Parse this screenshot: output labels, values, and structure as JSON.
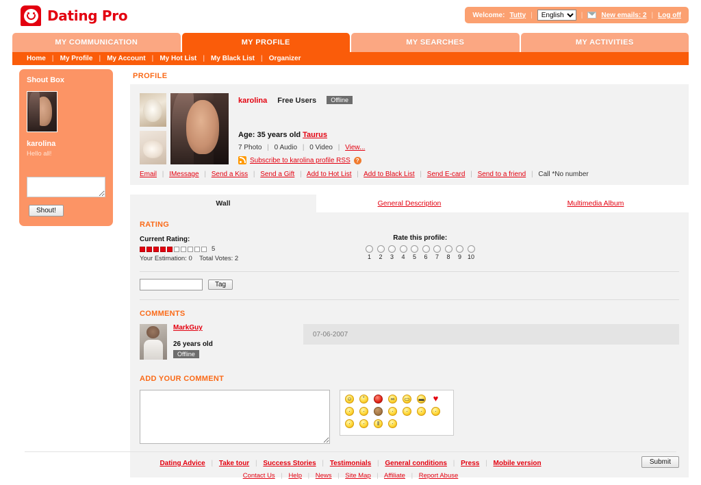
{
  "brand": {
    "name": "Dating Pro",
    "logo_icon": "smiley-logo-icon",
    "accent": "#e3000f",
    "orange": "#fa5c0a"
  },
  "welcome": {
    "prefix": "Welcome:",
    "username": "Tutty",
    "language": "English",
    "language_options": [
      "English"
    ],
    "mail_icon": "envelope-icon",
    "new_emails": "New emails: 2",
    "logoff": "Log off",
    "sep": "|"
  },
  "tabs": [
    {
      "label": "MY COMMUNICATION",
      "active": false
    },
    {
      "label": "MY PROFILE",
      "active": true
    },
    {
      "label": "MY SEARCHES",
      "active": false
    },
    {
      "label": "MY ACTIVITIES",
      "active": false
    }
  ],
  "subnav": [
    "Home",
    "My Profile",
    "My Account",
    "My Hot List",
    "My Black List",
    "Organizer"
  ],
  "shoutbox": {
    "title": "Shout Box",
    "avatar_icon": "karolina-avatar",
    "name": "karolina",
    "message": "Hello all!",
    "input_value": "",
    "button_label": "Shout!"
  },
  "main": {
    "section_title": "PROFILE",
    "profile": {
      "thumbs": [
        "cat-thumb-1",
        "cat-thumb-2"
      ],
      "main_photo": "karolina-main-photo",
      "name": "karolina",
      "user_type": "Free Users",
      "status": "Offline",
      "age_label": "Age: 35 years old",
      "zodiac": "Taurus",
      "photo_count": "7 Photo",
      "audio_count": "0 Audio",
      "video_count": "0 Video",
      "view_link": "View...",
      "rss_icon": "rss-icon",
      "rss_link": "Subscribe to karolina profile RSS",
      "help_icon": "question-icon",
      "actions": [
        "Email",
        "IMessage",
        "Send a Kiss",
        "Send a Gift",
        "Add to Hot List",
        "Add to Black List",
        "Send E-card",
        "Send to a friend"
      ],
      "call_text": "Call *No number"
    },
    "content_tabs": [
      {
        "label": "Wall",
        "active": true
      },
      {
        "label": "General Description",
        "active": false
      },
      {
        "label": "Multimedia Album",
        "active": false
      }
    ],
    "rating": {
      "heading": "RATING",
      "current_label": "Current Rating:",
      "filled": 5,
      "total": 10,
      "score": "5",
      "your_estimation": "Your Estimation: 0",
      "total_votes": "Total Votes: 2",
      "rate_title": "Rate this profile:",
      "rate_values": [
        "1",
        "2",
        "3",
        "4",
        "5",
        "6",
        "7",
        "8",
        "9",
        "10"
      ]
    },
    "tag": {
      "input_value": "",
      "button_label": "Tag"
    },
    "comments": {
      "heading": "COMMENTS",
      "items": [
        {
          "avatar_icon": "markguy-avatar",
          "author": "MarkGuy",
          "age": "26 years old",
          "status": "Offline",
          "date": "07-06-2007",
          "text": ""
        }
      ]
    },
    "add_comment": {
      "heading": "ADD YOUR COMMENT",
      "textarea_value": "",
      "emoticons": [
        "smile-icon",
        "sweat-icon",
        "devil-icon",
        "nerd-icon",
        "grin-icon",
        "cool-icon",
        "heart-icon",
        "happy-icon",
        "kiss-icon",
        "monkey-icon",
        "neutral-icon",
        "surprised-icon",
        "wink-icon",
        "scared-icon",
        "tongue-icon",
        "blush-icon",
        "shush-icon",
        "smirk-icon"
      ],
      "submit_label": "Submit"
    }
  },
  "footer": {
    "primary": [
      "Dating Advice",
      "Take tour",
      "Success Stories",
      "Testimonials",
      "General conditions",
      "Press",
      "Mobile version"
    ],
    "secondary": [
      "Contact Us",
      "Help",
      "News",
      "Site Map",
      "Affiliate",
      "Report Abuse"
    ],
    "sep": "|"
  }
}
